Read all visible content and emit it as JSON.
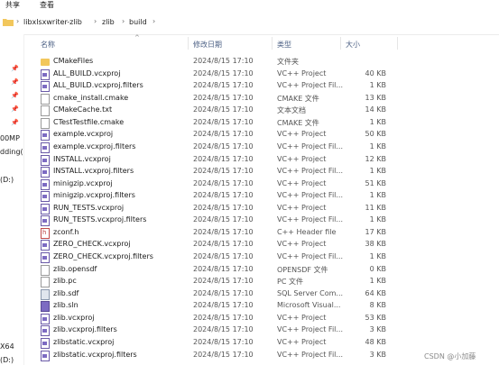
{
  "ribbon": {
    "share": "共享",
    "view": "查看"
  },
  "address": {
    "crumbs": [
      "libxlsxwriter-zlib",
      "zlib",
      "build"
    ]
  },
  "nav_fragments": [
    "00MP",
    "dding(",
    "(D:)",
    "X64",
    "(D:)"
  ],
  "columns": {
    "name": "名称",
    "date": "修改日期",
    "type": "类型",
    "size": "大小"
  },
  "files": [
    {
      "name": "CMakeFiles",
      "date": "2024/8/15 17:10",
      "type": "文件夹",
      "size": "",
      "icon": "folder"
    },
    {
      "name": "ALL_BUILD.vcxproj",
      "date": "2024/8/15 17:10",
      "type": "VC++ Project",
      "size": "40 KB",
      "icon": "vcxproj"
    },
    {
      "name": "ALL_BUILD.vcxproj.filters",
      "date": "2024/8/15 17:10",
      "type": "VC++ Project Fil...",
      "size": "1 KB",
      "icon": "vcxproj"
    },
    {
      "name": "cmake_install.cmake",
      "date": "2024/8/15 17:10",
      "type": "CMAKE 文件",
      "size": "13 KB",
      "icon": "file"
    },
    {
      "name": "CMakeCache.txt",
      "date": "2024/8/15 17:10",
      "type": "文本文档",
      "size": "14 KB",
      "icon": "file"
    },
    {
      "name": "CTestTestfile.cmake",
      "date": "2024/8/15 17:10",
      "type": "CMAKE 文件",
      "size": "1 KB",
      "icon": "file"
    },
    {
      "name": "example.vcxproj",
      "date": "2024/8/15 17:10",
      "type": "VC++ Project",
      "size": "50 KB",
      "icon": "vcxproj"
    },
    {
      "name": "example.vcxproj.filters",
      "date": "2024/8/15 17:10",
      "type": "VC++ Project Fil...",
      "size": "1 KB",
      "icon": "vcxproj"
    },
    {
      "name": "INSTALL.vcxproj",
      "date": "2024/8/15 17:10",
      "type": "VC++ Project",
      "size": "12 KB",
      "icon": "vcxproj"
    },
    {
      "name": "INSTALL.vcxproj.filters",
      "date": "2024/8/15 17:10",
      "type": "VC++ Project Fil...",
      "size": "1 KB",
      "icon": "vcxproj"
    },
    {
      "name": "minigzip.vcxproj",
      "date": "2024/8/15 17:10",
      "type": "VC++ Project",
      "size": "51 KB",
      "icon": "vcxproj"
    },
    {
      "name": "minigzip.vcxproj.filters",
      "date": "2024/8/15 17:10",
      "type": "VC++ Project Fil...",
      "size": "1 KB",
      "icon": "vcxproj"
    },
    {
      "name": "RUN_TESTS.vcxproj",
      "date": "2024/8/15 17:10",
      "type": "VC++ Project",
      "size": "11 KB",
      "icon": "vcxproj"
    },
    {
      "name": "RUN_TESTS.vcxproj.filters",
      "date": "2024/8/15 17:10",
      "type": "VC++ Project Fil...",
      "size": "1 KB",
      "icon": "vcxproj"
    },
    {
      "name": "zconf.h",
      "date": "2024/8/15 17:10",
      "type": "C++ Header file",
      "size": "17 KB",
      "icon": "header"
    },
    {
      "name": "ZERO_CHECK.vcxproj",
      "date": "2024/8/15 17:10",
      "type": "VC++ Project",
      "size": "38 KB",
      "icon": "vcxproj"
    },
    {
      "name": "ZERO_CHECK.vcxproj.filters",
      "date": "2024/8/15 17:10",
      "type": "VC++ Project Fil...",
      "size": "1 KB",
      "icon": "vcxproj"
    },
    {
      "name": "zlib.opensdf",
      "date": "2024/8/15 17:10",
      "type": "OPENSDF 文件",
      "size": "0 KB",
      "icon": "file"
    },
    {
      "name": "zlib.pc",
      "date": "2024/8/15 17:10",
      "type": "PC 文件",
      "size": "1 KB",
      "icon": "file"
    },
    {
      "name": "zlib.sdf",
      "date": "2024/8/15 17:10",
      "type": "SQL Server Com...",
      "size": "64 KB",
      "icon": "sdf"
    },
    {
      "name": "zlib.sln",
      "date": "2024/8/15 17:10",
      "type": "Microsoft Visual...",
      "size": "8 KB",
      "icon": "sln"
    },
    {
      "name": "zlib.vcxproj",
      "date": "2024/8/15 17:10",
      "type": "VC++ Project",
      "size": "53 KB",
      "icon": "vcxproj"
    },
    {
      "name": "zlib.vcxproj.filters",
      "date": "2024/8/15 17:10",
      "type": "VC++ Project Fil...",
      "size": "3 KB",
      "icon": "vcxproj"
    },
    {
      "name": "zlibstatic.vcxproj",
      "date": "2024/8/15 17:10",
      "type": "VC++ Project",
      "size": "48 KB",
      "icon": "vcxproj"
    },
    {
      "name": "zlibstatic.vcxproj.filters",
      "date": "2024/8/15 17:10",
      "type": "VC++ Project Fil...",
      "size": "3 KB",
      "icon": "vcxproj"
    }
  ],
  "watermark": "CSDN @小加藤"
}
